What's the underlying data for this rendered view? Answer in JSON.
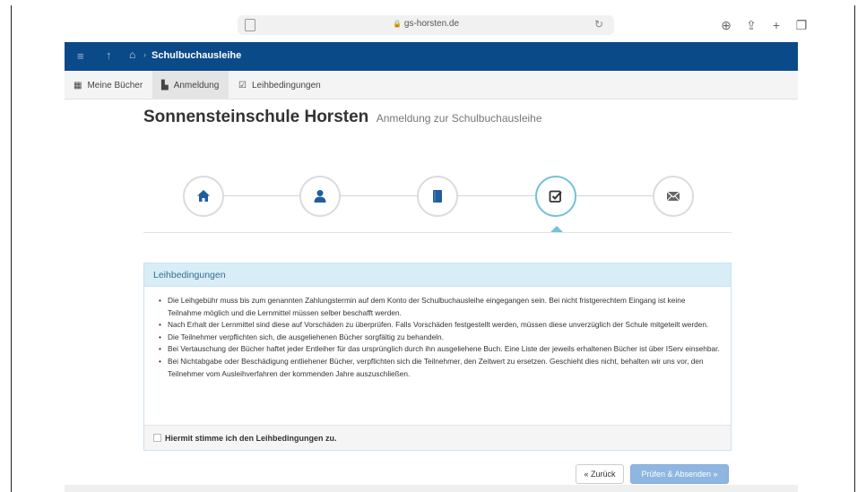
{
  "browser": {
    "url": "gs-horsten.de",
    "icons": [
      "download-icon",
      "share-icon",
      "new-tab-icon",
      "tabs-icon"
    ]
  },
  "navbar": {
    "title": "Schulbuchausleihe"
  },
  "subtabs": [
    {
      "label": "Meine Bücher",
      "icon": "book-icon"
    },
    {
      "label": "Anmeldung",
      "icon": "document-icon",
      "active": true
    },
    {
      "label": "Leihbedingungen",
      "icon": "checkbox-icon"
    }
  ],
  "heading": {
    "school": "Sonnensteinschule Horsten",
    "subtitle": "Anmeldung zur Schulbuchausleihe"
  },
  "steps": [
    {
      "icon": "home-icon"
    },
    {
      "icon": "user-icon"
    },
    {
      "icon": "book-icon"
    },
    {
      "icon": "checkbox-icon",
      "active": true
    },
    {
      "icon": "envelope-icon"
    }
  ],
  "panel": {
    "title": "Leihbedingungen",
    "items": [
      "Die Leihgebühr muss bis zum genannten Zahlungstermin auf dem Konto der Schulbuchausleihe eingegangen sein. Bei nicht fristgerechtem Eingang ist keine Teilnahme möglich und die Lernmittel müssen selber beschafft werden.",
      "Nach Erhalt der Lernmittel sind diese auf Vorschäden zu überprüfen. Falls Vorschäden festgestellt werden, müssen diese unverzüglich der Schule mitgeteilt werden.",
      "Die Teilnehmer verpflichten sich, die ausgeliehenen Bücher sorgfältig zu behandeln.",
      "Bei Vertauschung der Bücher haftet jeder Entleiher für das ursprünglich durch ihn ausgeliehene Buch. Eine Liste der jeweils erhaltenen Bücher ist über IServ einsehbar.",
      "Bei Nichtabgabe oder Beschädigung entliehener Bücher, verpflichten sich die Teilnehmer, den Zeitwert zu ersetzen. Geschieht dies nicht, behalten wir uns vor, den Teilnehmer vom Ausleihverfahren der kommenden Jahre auszuschließen."
    ],
    "agree_label": "Hiermit stimme ich den Leihbedingungen zu.",
    "agree_checked": false
  },
  "buttons": {
    "back": "« Zurück",
    "submit": "Prüfen & Absenden »"
  },
  "colors": {
    "navbar": "#0a4a88",
    "panel_heading": "#d9edf7",
    "active_step": "#74c1dd",
    "submit": "#8fb6e0"
  }
}
